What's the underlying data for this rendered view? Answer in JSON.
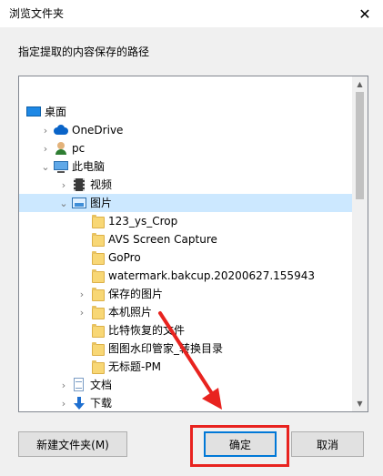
{
  "window": {
    "title": "浏览文件夹",
    "close_glyph": "✕"
  },
  "prompt": "指定提取的内容保存的路径",
  "tree": {
    "items": [
      {
        "label": "桌面",
        "icon": "desktop-icon",
        "level": 0,
        "expander": "none"
      },
      {
        "label": "OneDrive",
        "icon": "cloud-icon",
        "level": 1,
        "expander": "collapsed"
      },
      {
        "label": "pc",
        "icon": "user-icon",
        "level": 1,
        "expander": "collapsed"
      },
      {
        "label": "此电脑",
        "icon": "pc-icon",
        "level": 1,
        "expander": "expanded"
      },
      {
        "label": "视频",
        "icon": "video-icon",
        "level": 2,
        "expander": "collapsed"
      },
      {
        "label": "图片",
        "icon": "pictures-icon",
        "level": 2,
        "expander": "expanded",
        "selected": true
      },
      {
        "label": "123_ys_Crop",
        "icon": "folder-icon",
        "level": 3,
        "expander": "none"
      },
      {
        "label": "AVS Screen Capture",
        "icon": "folder-icon",
        "level": 3,
        "expander": "none"
      },
      {
        "label": "GoPro",
        "icon": "folder-icon",
        "level": 3,
        "expander": "none"
      },
      {
        "label": "watermark.bakcup.20200627.155943",
        "icon": "folder-icon",
        "level": 3,
        "expander": "none"
      },
      {
        "label": "保存的图片",
        "icon": "folder-icon",
        "level": 3,
        "expander": "collapsed"
      },
      {
        "label": "本机照片",
        "icon": "folder-icon",
        "level": 3,
        "expander": "collapsed"
      },
      {
        "label": "比特恢复的文件",
        "icon": "folder-icon",
        "level": 3,
        "expander": "none"
      },
      {
        "label": "图图水印管家_转换目录",
        "icon": "folder-icon",
        "level": 3,
        "expander": "none"
      },
      {
        "label": "无标题-PM",
        "icon": "folder-icon",
        "level": 3,
        "expander": "none"
      },
      {
        "label": "文档",
        "icon": "document-icon",
        "level": 2,
        "expander": "collapsed"
      },
      {
        "label": "下载",
        "icon": "download-icon",
        "level": 2,
        "expander": "collapsed"
      }
    ]
  },
  "buttons": {
    "new_folder": "新建文件夹(M)",
    "ok": "确定",
    "cancel": "取消"
  },
  "colors": {
    "selection": "#cce8ff",
    "annotation_red": "#e8231f",
    "default_button_border": "#0078d7"
  }
}
